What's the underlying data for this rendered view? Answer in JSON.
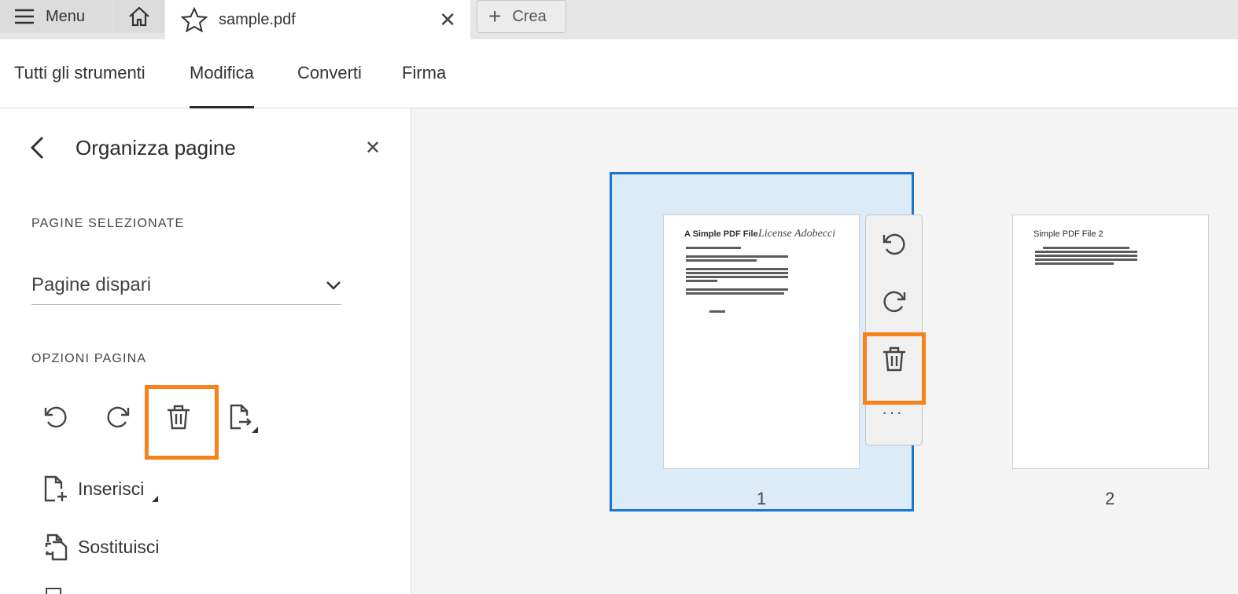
{
  "tabbar": {
    "menu_label": "Menu",
    "doc_tab_title": "sample.pdf",
    "create_label": "Crea"
  },
  "toolbar": {
    "tools": [
      "Tutti gli strumenti",
      "Modifica",
      "Converti",
      "Firma"
    ],
    "active": "Modifica"
  },
  "panel": {
    "title": "Organizza pagine",
    "selected_pages_heading": "PAGINE SELEZIONATE",
    "selected_pages_value": "Pagine dispari",
    "page_options_heading": "OPZIONI PAGINA",
    "insert_label": "Inserisci",
    "replace_label": "Sostituisci"
  },
  "pages": [
    {
      "number": "1",
      "selected": true,
      "title": "A Simple PDF File",
      "signature": "License Adobecci"
    },
    {
      "number": "2",
      "selected": false,
      "title": "Simple PDF File 2"
    }
  ],
  "colors": {
    "highlight": "#f7821b",
    "selection_border": "#1b74d0",
    "selection_fill": "#dcebf8"
  }
}
